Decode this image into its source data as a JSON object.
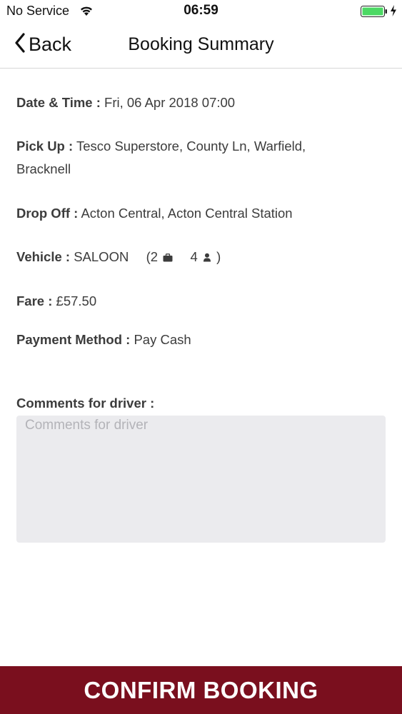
{
  "status_bar": {
    "carrier": "No Service",
    "time": "06:59",
    "battery_color": "#4cd964"
  },
  "nav": {
    "back_label": "Back",
    "title": "Booking Summary"
  },
  "summary": {
    "datetime": {
      "label": "Date & Time :",
      "value": "Fri, 06 Apr 2018 07:00"
    },
    "pickup": {
      "label": "Pick Up :",
      "value": "Tesco Superstore, County Ln, Warfield, Bracknell"
    },
    "dropoff": {
      "label": "Drop Off :",
      "value": "Acton Central, Acton Central Station"
    },
    "vehicle": {
      "label": "Vehicle :",
      "value": "SALOON",
      "open_paren": "(2",
      "luggage_icon": "briefcase-icon",
      "passengers": "4",
      "passenger_icon": "person-icon",
      "close_paren": ")"
    },
    "fare": {
      "label": "Fare :",
      "value": "£57.50"
    },
    "payment": {
      "label": "Payment Method :",
      "value": "Pay Cash"
    }
  },
  "comments": {
    "label": "Comments for driver :",
    "placeholder": "Comments for driver",
    "value": ""
  },
  "confirm_button": {
    "label": "CONFIRM BOOKING",
    "color": "#7a0f1e"
  }
}
